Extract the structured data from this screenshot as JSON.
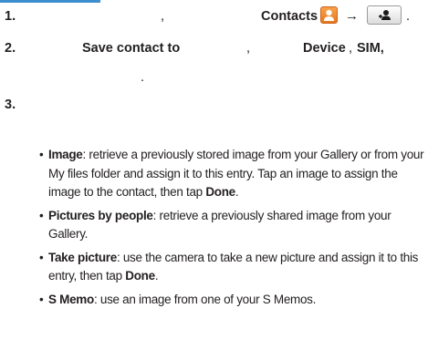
{
  "steps": [
    {
      "number": "1.",
      "comma": ",",
      "contacts_label": "Contacts",
      "arrow": "→",
      "end": "."
    },
    {
      "number": "2.",
      "save_to": "Save contact to",
      "comma": ",",
      "device": "Device",
      "sep": ",",
      "sim": "SIM,",
      "cont_dot": "."
    },
    {
      "number": "3."
    }
  ],
  "icons": {
    "contacts": "contacts-app-icon",
    "add_contact": "add-contact-button-icon"
  },
  "options": [
    {
      "bullet": "•",
      "name": "Image",
      "text": ": retrieve a previously stored image from your Gallery or from your My files folder and assign it to this entry. Tap an image to assign the image to the contact, then tap ",
      "bold2": "Done",
      "end": "."
    },
    {
      "bullet": "•",
      "name": "Pictures by people",
      "text": ": retrieve a previously shared image from your Gallery.",
      "bold2": "",
      "end": ""
    },
    {
      "bullet": "•",
      "name": "Take picture",
      "text": ": use the camera to take a new picture and assign it to this entry, then tap ",
      "bold2": "Done",
      "end": "."
    },
    {
      "bullet": "•",
      "name": "S Memo",
      "text": ": use an image from one of your S Memos.",
      "bold2": "",
      "end": ""
    }
  ],
  "colors": {
    "accent_line": "#3d8fd0",
    "contacts_icon": "#f08a2e"
  }
}
